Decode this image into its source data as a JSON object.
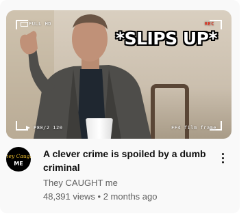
{
  "video": {
    "title": "A clever crime is spoiled by a dumb criminal",
    "channel": "They CAUGHT me",
    "views": "48,391 views",
    "separator": "•",
    "age": "2 months ago"
  },
  "thumbnail": {
    "overlay_text": "*SLIPS UP*",
    "cam_top_left": "FULL HD",
    "cam_top_right": "REC",
    "cam_bottom_left": "P80/2 120",
    "cam_bottom_right": "FF4 film frame"
  },
  "avatar": {
    "line1": "They Caught",
    "line2": "ME"
  },
  "menu": {
    "icon": "more-vert-icon"
  },
  "colors": {
    "title": "#0f0f0f",
    "secondary_text": "#606060",
    "card_bg": "#f9f9f9",
    "rec_red": "#e0301e",
    "avatar_text": "#f2c230"
  }
}
